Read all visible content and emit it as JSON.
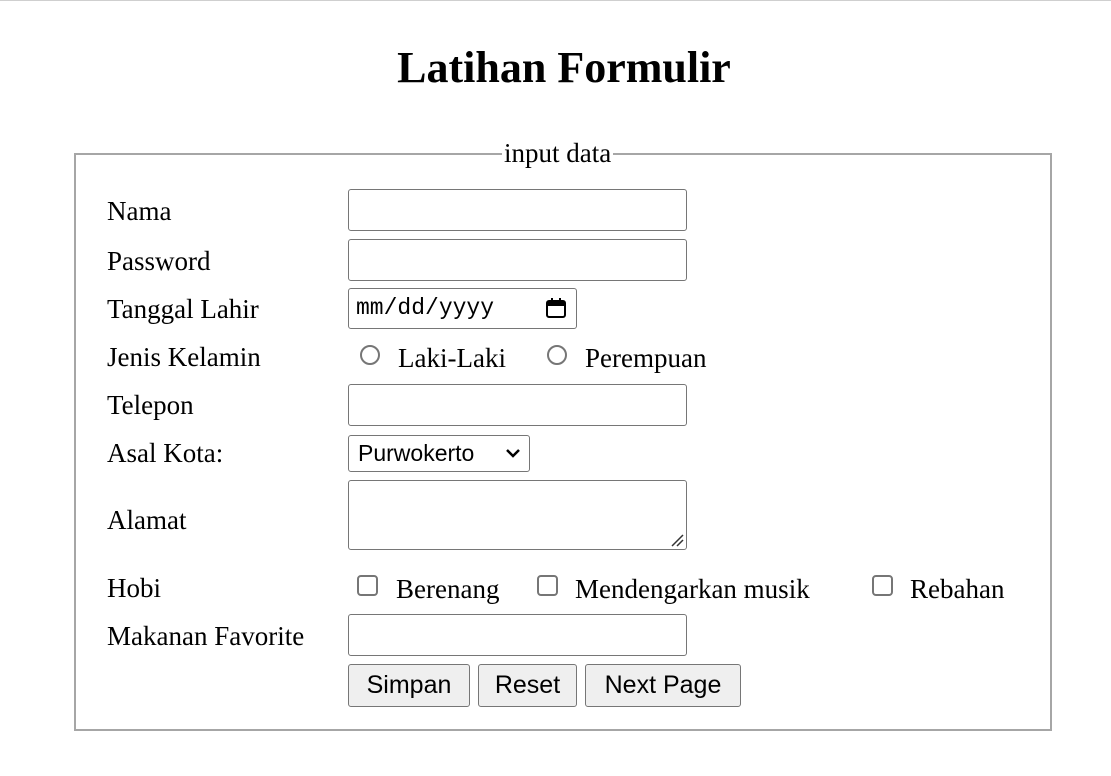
{
  "page": {
    "title": "Latihan Formulir"
  },
  "form": {
    "legend": "input data",
    "labels": {
      "nama": "Nama",
      "password": "Password",
      "tanggal_lahir": "Tanggal Lahir",
      "jenis_kelamin": "Jenis Kelamin",
      "telepon": "Telepon",
      "asal_kota": "Asal Kota:",
      "alamat": "Alamat",
      "hobi": "Hobi",
      "makanan_favorite": "Makanan Favorite"
    },
    "values": {
      "nama": "",
      "password": "",
      "telepon": "",
      "alamat": "",
      "makanan_favorite": ""
    },
    "date_placeholder": "mm/dd/yyyy",
    "gender_options": [
      "Laki-Laki",
      "Perempuan"
    ],
    "city_selected": "Purwokerto",
    "hobby_options": [
      "Berenang",
      "Mendengarkan musik",
      "Rebahan"
    ],
    "buttons": {
      "simpan": "Simpan",
      "reset": "Reset",
      "next": "Next Page"
    }
  },
  "icons": {
    "date_picker": "calendar-icon",
    "select_arrow": "chevron-down-icon",
    "textarea_resize": "resize-grip-icon"
  },
  "colors": {
    "border": "#767676",
    "fieldset_border": "#a6a6a6",
    "button_bg": "#efefef"
  }
}
